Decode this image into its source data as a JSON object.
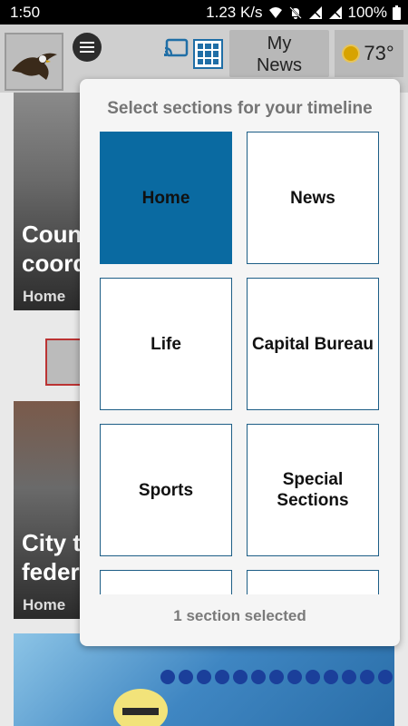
{
  "status_bar": {
    "time": "1:50",
    "network_speed": "1.23 K/s",
    "battery": "100%"
  },
  "header": {
    "logo_icon": "eagle-logo",
    "my_news_label": "My\nNews",
    "temperature": "73°"
  },
  "feed": {
    "card1": {
      "headline": "Coun\ncoord",
      "meta": "Home"
    },
    "card2": {
      "headline": "City t\nfeder",
      "meta": "Home"
    }
  },
  "modal": {
    "title": "Select sections for your timeline",
    "sections": [
      {
        "label": "Home",
        "selected": true
      },
      {
        "label": "News",
        "selected": false
      },
      {
        "label": "Life",
        "selected": false
      },
      {
        "label": "Capital Bureau",
        "selected": false
      },
      {
        "label": "Sports",
        "selected": false
      },
      {
        "label": "Special Sections",
        "selected": false
      },
      {
        "label": "",
        "selected": false
      },
      {
        "label": "",
        "selected": false
      }
    ],
    "footer": "1 section selected"
  },
  "colors": {
    "accent": "#0a6aa1",
    "tile_border": "#1d5e86"
  }
}
